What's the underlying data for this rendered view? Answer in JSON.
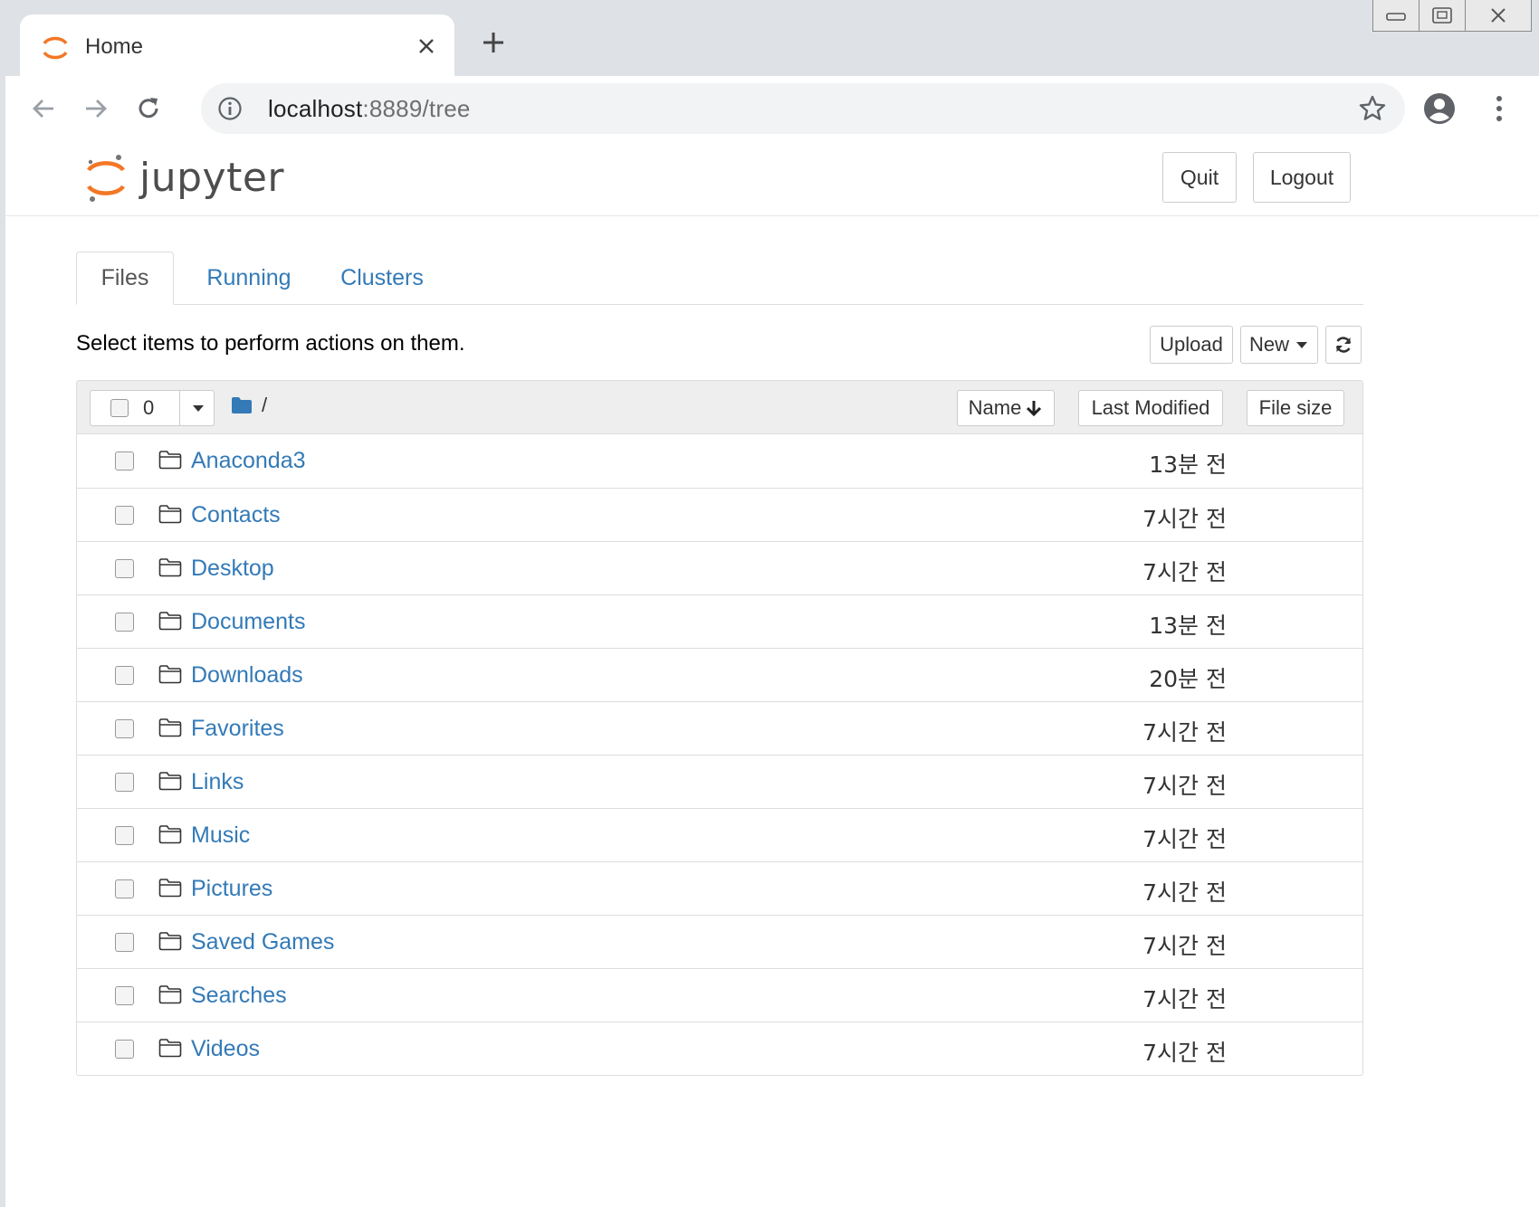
{
  "browser": {
    "tab_title": "Home",
    "url_host": "localhost",
    "url_rest": ":8889/tree"
  },
  "header": {
    "logo_text": "jupyter",
    "quit_label": "Quit",
    "logout_label": "Logout"
  },
  "tabs": [
    {
      "label": "Files"
    },
    {
      "label": "Running"
    },
    {
      "label": "Clusters"
    }
  ],
  "toolbar": {
    "hint": "Select items to perform actions on them.",
    "upload_label": "Upload",
    "new_label": "New"
  },
  "list_header": {
    "selected_count": "0",
    "breadcrumb": "/",
    "name_label": "Name",
    "modified_label": "Last Modified",
    "size_label": "File size"
  },
  "files": [
    {
      "name": "Anaconda3",
      "modified": "13분 전"
    },
    {
      "name": "Contacts",
      "modified": "7시간 전"
    },
    {
      "name": "Desktop",
      "modified": "7시간 전"
    },
    {
      "name": "Documents",
      "modified": "13분 전"
    },
    {
      "name": "Downloads",
      "modified": "20분 전"
    },
    {
      "name": "Favorites",
      "modified": "7시간 전"
    },
    {
      "name": "Links",
      "modified": "7시간 전"
    },
    {
      "name": "Music",
      "modified": "7시간 전"
    },
    {
      "name": "Pictures",
      "modified": "7시간 전"
    },
    {
      "name": "Saved Games",
      "modified": "7시간 전"
    },
    {
      "name": "Searches",
      "modified": "7시간 전"
    },
    {
      "name": "Videos",
      "modified": "7시간 전"
    }
  ],
  "colors": {
    "link": "#337ab7",
    "jupyter_orange": "#f37726"
  }
}
